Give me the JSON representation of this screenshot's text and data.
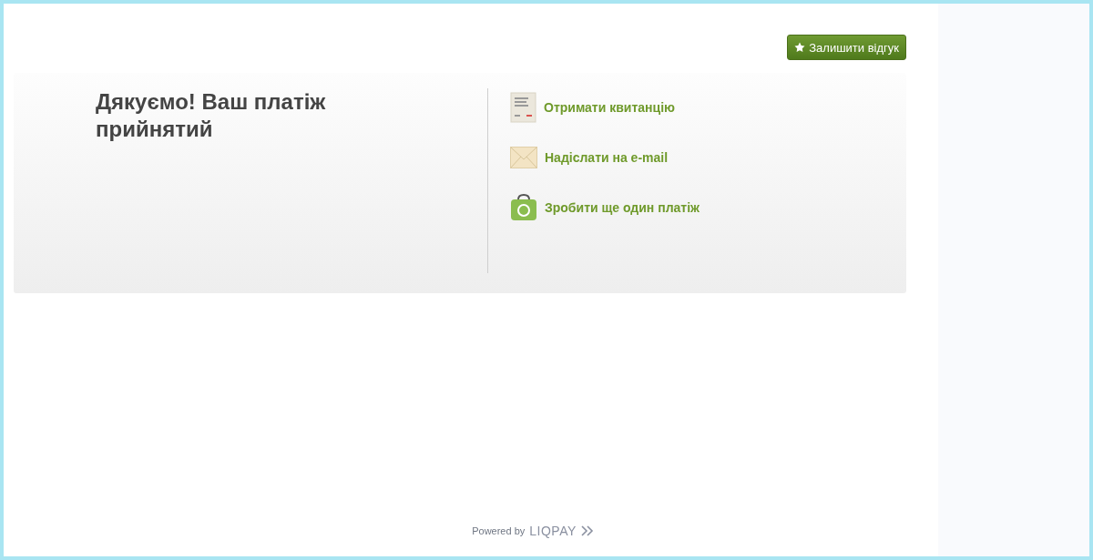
{
  "feedback_button": {
    "label": "Залишити відгук"
  },
  "title": "Дякуємо! Ваш платіж прийнятий",
  "actions": [
    {
      "kind": "receipt",
      "label": "Отримати квитанцію"
    },
    {
      "kind": "envelope",
      "label": "Надіслати на e-mail"
    },
    {
      "kind": "wallet",
      "label": "Зробити ще один платіж"
    }
  ],
  "footer": {
    "powered_by": "Powered by",
    "brand": "LIQPAY"
  }
}
